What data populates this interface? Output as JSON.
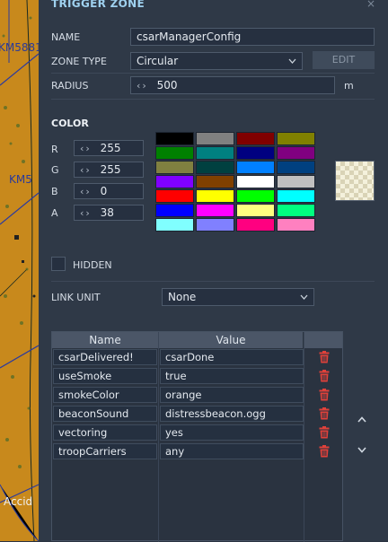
{
  "map": {
    "labels": [
      "KM5881",
      "KM5",
      "Accid"
    ]
  },
  "window": {
    "title": "TRIGGER ZONE",
    "close_glyph": "×"
  },
  "name": {
    "label": "NAME",
    "value": "csarManagerConfig"
  },
  "zone_type": {
    "label": "ZONE TYPE",
    "value": "Circular",
    "edit_label": "EDIT"
  },
  "radius": {
    "label": "RADIUS",
    "value": "500",
    "unit": "m"
  },
  "color": {
    "header": "COLOR",
    "channels": [
      {
        "label": "R",
        "value": "255"
      },
      {
        "label": "G",
        "value": "255"
      },
      {
        "label": "B",
        "value": "0"
      },
      {
        "label": "A",
        "value": "38"
      }
    ],
    "palette": [
      [
        "#000000",
        "#808080",
        "#800000",
        "#808000"
      ],
      [
        "#008000",
        "#008080",
        "#000080",
        "#800080"
      ],
      [
        "#808040",
        "#004040",
        "#0080ff",
        "#004080"
      ],
      [
        "#8000ff",
        "#804000",
        "#ffffff",
        "#c0c0c0"
      ],
      [
        "#ff0000",
        "#ffff00",
        "#00ff00",
        "#00ffff"
      ],
      [
        "#0000ff",
        "#ff00ff",
        "#ffff80",
        "#00ff80"
      ],
      [
        "#80ffff",
        "#8080ff",
        "#ff0080",
        "#ff80c0"
      ]
    ]
  },
  "hidden": {
    "label": "HIDDEN",
    "checked": false
  },
  "link_unit": {
    "label": "LINK UNIT",
    "value": "None"
  },
  "properties": {
    "headers": [
      "Name",
      "Value"
    ],
    "rows": [
      {
        "name": "csarDelivered!",
        "value": "csarDone"
      },
      {
        "name": "useSmoke",
        "value": "true"
      },
      {
        "name": "smokeColor",
        "value": "orange"
      },
      {
        "name": "beaconSound",
        "value": "distressbeacon.ogg"
      },
      {
        "name": "vectoring",
        "value": "yes"
      },
      {
        "name": "troopCarriers",
        "value": "any"
      }
    ]
  },
  "icons": {
    "delete": "trash-icon",
    "up": "chevron-up-icon",
    "down": "chevron-down-icon",
    "spin": "spin-arrows-icon"
  }
}
